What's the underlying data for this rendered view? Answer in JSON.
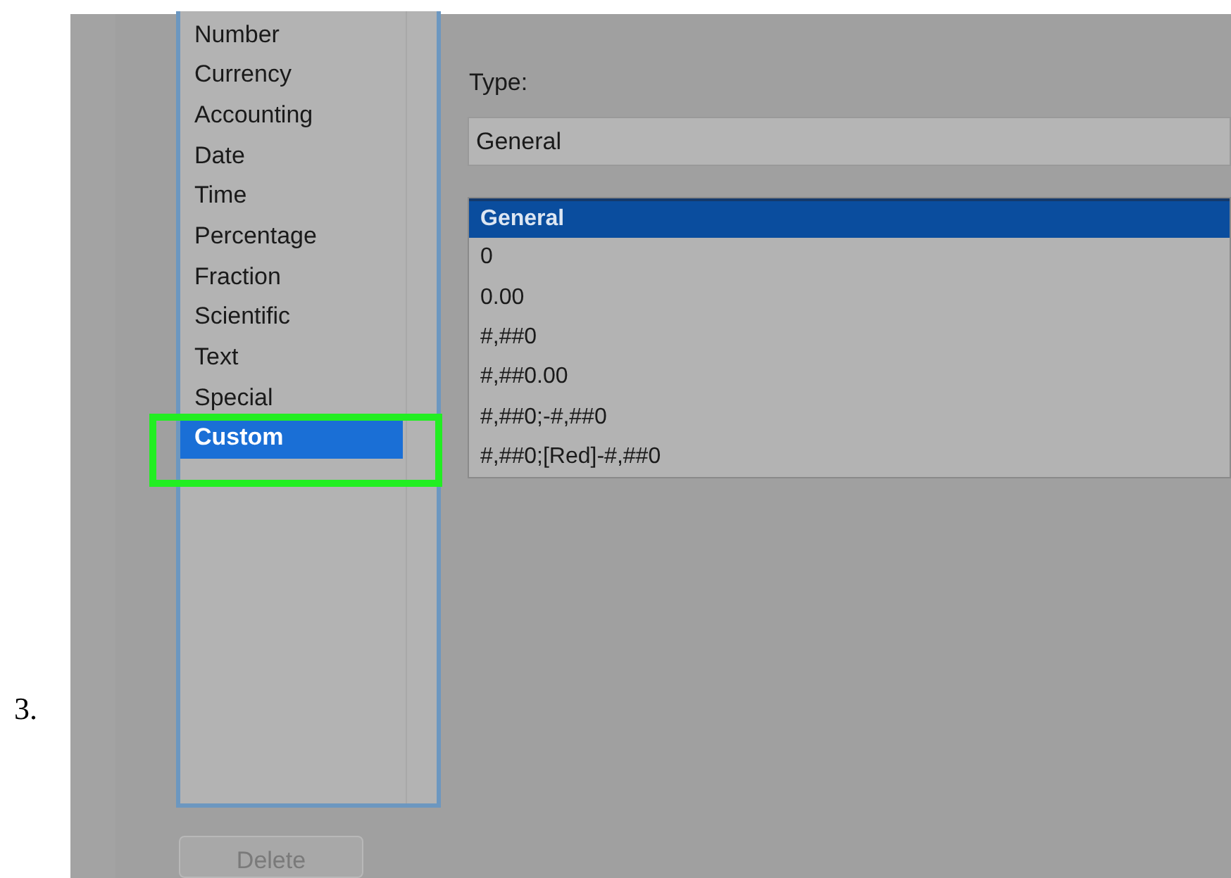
{
  "step_number": "3.",
  "category_list": {
    "items": [
      {
        "label": "Number",
        "selected": false
      },
      {
        "label": "Currency",
        "selected": false
      },
      {
        "label": "Accounting",
        "selected": false
      },
      {
        "label": "Date",
        "selected": false
      },
      {
        "label": "Time",
        "selected": false
      },
      {
        "label": "Percentage",
        "selected": false
      },
      {
        "label": "Fraction",
        "selected": false
      },
      {
        "label": "Scientific",
        "selected": false
      },
      {
        "label": "Text",
        "selected": false
      },
      {
        "label": "Special",
        "selected": false
      },
      {
        "label": "Custom",
        "selected": true,
        "highlighted": true
      }
    ]
  },
  "type_label": "Type:",
  "type_field": {
    "value": "General"
  },
  "format_list": {
    "items": [
      {
        "label": "General",
        "selected": true
      },
      {
        "label": "0",
        "selected": false
      },
      {
        "label": "0.00",
        "selected": false
      },
      {
        "label": "#,##0",
        "selected": false
      },
      {
        "label": "#,##0.00",
        "selected": false
      },
      {
        "label": "#,##0;-#,##0",
        "selected": false
      },
      {
        "label": "#,##0;[Red]-#,##0",
        "selected": false
      }
    ]
  },
  "delete_button": {
    "label": "Delete",
    "disabled": true
  }
}
